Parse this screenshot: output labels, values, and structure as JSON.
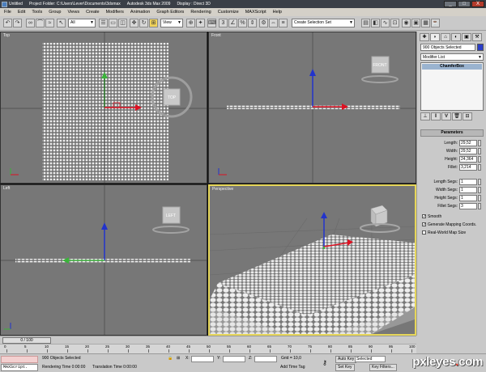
{
  "titlebar": {
    "doc": "Untitled",
    "project": "Project Folder: C:\\Users\\Lever\\Documents\\3dsmax",
    "app": "Autodesk 3ds Max 2009",
    "display": "Display : Direct 3D",
    "min": "_",
    "max": "□",
    "close": "X"
  },
  "menu": [
    "File",
    "Edit",
    "Tools",
    "Group",
    "Views",
    "Create",
    "Modifiers",
    "Animation",
    "Graph Editors",
    "Rendering",
    "Customize",
    "MAXScript",
    "Help"
  ],
  "toolbar": {
    "filter": "All",
    "refcoord": "View",
    "selection_set": "Create Selection Set"
  },
  "viewports": {
    "top": {
      "label": "Top",
      "viewcube": "TOP"
    },
    "front": {
      "label": "Front",
      "viewcube": "FRONT"
    },
    "left": {
      "label": "Left",
      "viewcube": "LEFT"
    },
    "perspective": {
      "label": "Perspective"
    }
  },
  "command_panel": {
    "selected": "900 Objects Selected",
    "modifier_list": "Modifier List",
    "stack_item": "ChamferBox",
    "parameters_title": "Parameters",
    "params": [
      {
        "label": "Length:",
        "value": "29,52"
      },
      {
        "label": "Width:",
        "value": "29,52"
      },
      {
        "label": "Height:",
        "value": "24,364"
      },
      {
        "label": "Fillet:",
        "value": "3,214"
      },
      {
        "label": "Length Segs:",
        "value": "1"
      },
      {
        "label": "Width Segs:",
        "value": "1"
      },
      {
        "label": "Height Segs:",
        "value": "1"
      },
      {
        "label": "Fillet Segs:",
        "value": "3"
      }
    ],
    "checks": [
      {
        "label": "Smooth",
        "checked": "✓"
      },
      {
        "label": "Generate Mapping Coords.",
        "checked": "✓"
      },
      {
        "label": "Real-World Map Size",
        "checked": ""
      }
    ]
  },
  "timeline": {
    "frame": "0 / 100",
    "ticks": [
      "0",
      "5",
      "10",
      "15",
      "20",
      "25",
      "30",
      "35",
      "40",
      "45",
      "50",
      "55",
      "60",
      "65",
      "70",
      "75",
      "80",
      "85",
      "90",
      "95",
      "100"
    ]
  },
  "status": {
    "maxscript": "MAXScript.",
    "selected": "900 Objects Selected",
    "rendering_time": "Rendering Time  0:00:00",
    "translation_time": "Translation Time  0:00:00",
    "x_label": "X:",
    "y_label": "Y:",
    "z_label": "Z:",
    "grid": "Grid = 10,0",
    "add_time_tag": "Add Time Tag",
    "auto_key": "Auto Key",
    "selected_mode": "Selected",
    "set_key": "Set Key",
    "key_filters": "Key Filters..."
  },
  "watermark": {
    "pre": "px",
    "main": "leyes",
    "dot": ".",
    "tld": "com"
  },
  "colors": {
    "viewport_bg": "#777777",
    "active_border": "#e6d65a",
    "grid_line": "#5e5e5e"
  }
}
